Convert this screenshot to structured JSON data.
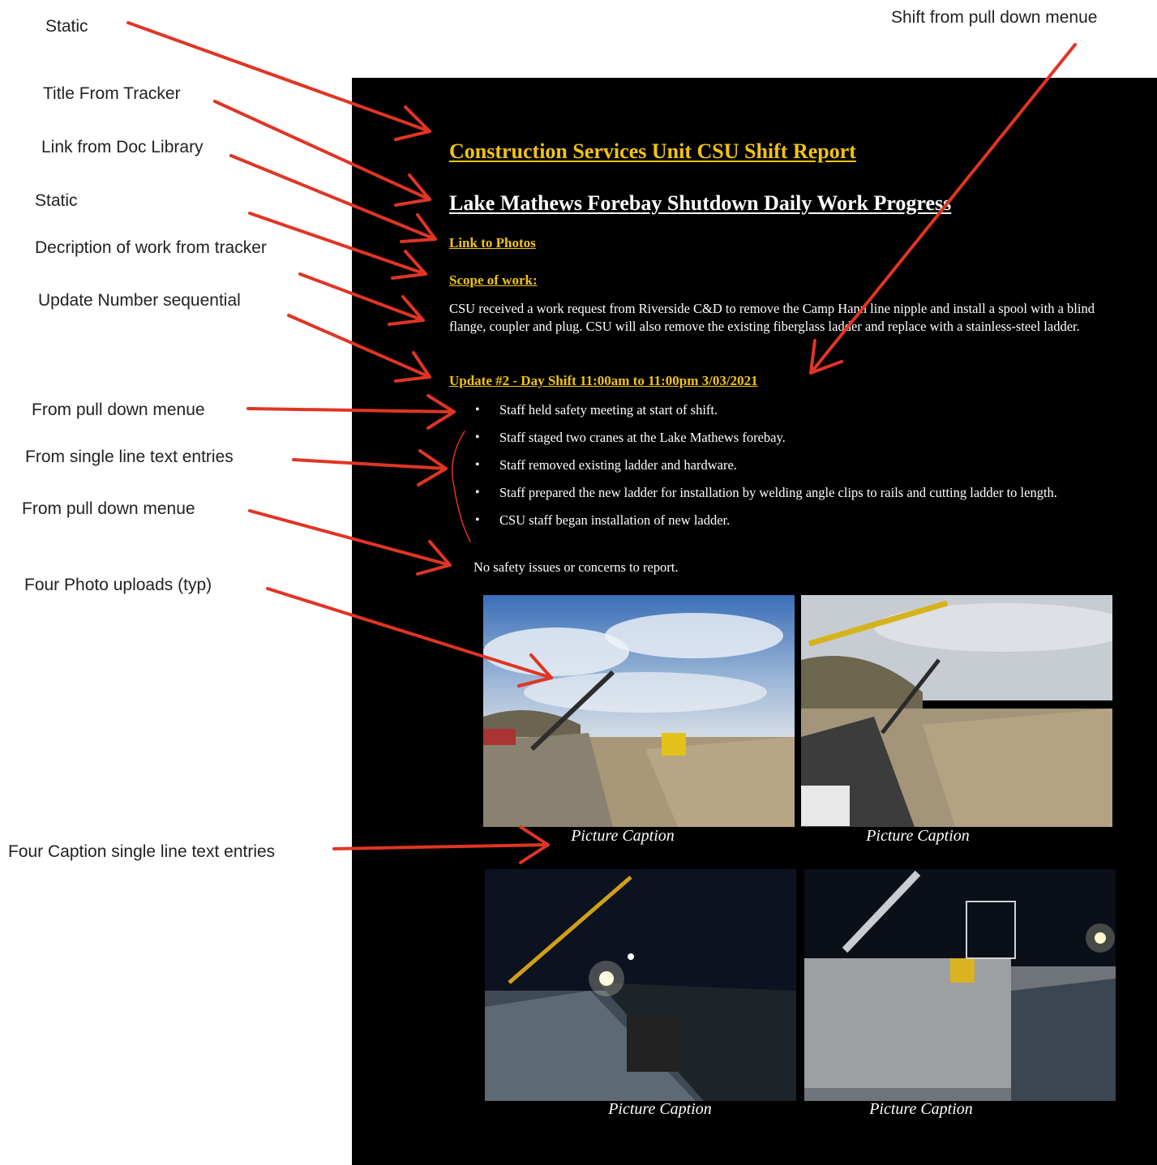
{
  "annotations": {
    "static_1": "Static",
    "shift_menu": "Shift from pull down menue",
    "title_tracker": "Title From Tracker",
    "link_library": "Link from Doc Library",
    "static_2": "Static",
    "description_tracker": "Decription of work from tracker",
    "update_number": "Update Number sequential",
    "pulldown_1": "From pull down menue",
    "single_line": "From single line text entries",
    "pulldown_2": "From pull down menue",
    "photo_uploads": "Four Photo uploads (typ)",
    "caption_entries": "Four Caption single line text entries"
  },
  "report": {
    "title": "Construction Services Unit CSU Shift Report",
    "project_title": "Lake Mathews Forebay Shutdown Daily Work Progress",
    "photos_link": "Link to Photos",
    "scope_label": "Scope of work:",
    "scope_text": "CSU received a work request from Riverside C&D to remove the Camp Hann line nipple and install a spool with a blind flange, coupler and plug. CSU will also remove the existing fiberglass ladder and replace with a stainless-steel ladder.",
    "update_heading": "Update #2 - Day Shift 11:00am to 11:00pm 3/03/2021",
    "work_items": [
      "Staff held safety meeting at start of shift.",
      "Staff staged two cranes at the Lake Mathews forebay.",
      "Staff removed existing ladder and hardware.",
      "Staff prepared the new ladder for installation by welding angle clips to rails and cutting ladder to length.",
      "CSU staff began installation of new ladder."
    ],
    "bullet": "•",
    "safety_note": "No safety issues or concerns to report.",
    "captions": [
      "Picture Caption",
      "Picture Caption",
      "Picture Caption",
      "Picture Caption"
    ]
  },
  "colors": {
    "document_bg": "#000000",
    "accent_yellow": "#f2c40f",
    "arrow_red": "#e03524",
    "text_white": "#ffffff"
  }
}
